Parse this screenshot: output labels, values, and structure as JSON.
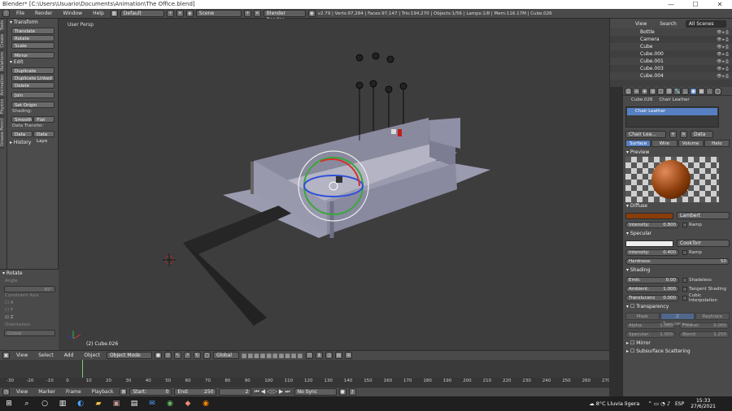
{
  "window": {
    "title": "Blender* [C:\\Users\\Usuario\\Documents\\Animation\\The Office.blend]",
    "min": "—",
    "max": "☐",
    "close": "✕"
  },
  "infobar": {
    "menus": [
      "File",
      "Render",
      "Window",
      "Help"
    ],
    "layout": "Default",
    "scene": "Scene",
    "engine": "Blender Render",
    "stats": "v2.79 | Verts:97,284 | Faces:97,147 | Tris:194,270 | Objects:1/56 | Lamps:1/8 | Mem:116.17M | Cube.026"
  },
  "vtabs": [
    "Tools",
    "Create",
    "Relations",
    "Animation",
    "Physics",
    "Grease Pencil"
  ],
  "tools": {
    "transform_head": "Transform",
    "translate": "Translate",
    "rotate": "Rotate",
    "scale": "Scale",
    "mirror": "Mirror",
    "edit_head": "Edit",
    "duplicate": "Duplicate",
    "duplicate_linked": "Duplicate Linked",
    "delete": "Delete",
    "join": "Join",
    "set_origin": "Set Origin",
    "shading_label": "Shading:",
    "smooth": "Smooth",
    "flat": "Flat",
    "data_transfer_label": "Data Transfer:",
    "data": "Data",
    "data_layout": "Data Layo",
    "history_head": "History"
  },
  "rotate_panel": {
    "head": "Rotate",
    "angle_label": "Angle",
    "angle_value": "45°",
    "constraint_label": "Constraint Axis",
    "x": "X",
    "y": "Y",
    "z": "Z",
    "orientation_label": "Orientation",
    "orientation_value": "Global"
  },
  "viewport": {
    "label": "User Persp",
    "object": "(2) Cube.026"
  },
  "viewport_header": {
    "view": "View",
    "select": "Select",
    "add": "Add",
    "object": "Object",
    "mode": "Object Mode",
    "orientation": "Global"
  },
  "timeline": {
    "ticks": [
      "-30",
      "-20",
      "-10",
      "0",
      "10",
      "20",
      "30",
      "40",
      "50",
      "60",
      "70",
      "80",
      "90",
      "100",
      "110",
      "120",
      "130",
      "140",
      "150",
      "160",
      "170",
      "180",
      "190",
      "200",
      "210",
      "220",
      "230",
      "240",
      "250",
      "260",
      "270"
    ]
  },
  "timeline_header": {
    "view": "View",
    "marker": "Marker",
    "frame": "Frame",
    "playback": "Playback",
    "start_label": "Start:",
    "start_value": "0",
    "end_label": "End:",
    "end_value": "250",
    "current": "2",
    "sync": "No Sync"
  },
  "outliner": {
    "view": "View",
    "search": "Search",
    "filter": "All Scenes",
    "rows": [
      "Bottle",
      "Camera",
      "Cube",
      "Cube.000",
      "Cube.001",
      "Cube.003",
      "Cube.004"
    ]
  },
  "properties": {
    "breadcrumb_obj": "Cube.026",
    "breadcrumb_mat": "Chair Leather",
    "material_slot": "Chair Leather",
    "material_field": "Chair Lea...",
    "data": "Data",
    "tabs": [
      "Surface",
      "Wire",
      "Volume",
      "Halo"
    ],
    "preview_head": "Preview",
    "diffuse_head": "Diffuse",
    "diffuse_color": "#8a3d0a",
    "diffuse_shader": "Lambert",
    "intensity_label": "Intensity:",
    "diffuse_intensity": "0.800",
    "ramp": "Ramp",
    "specular_head": "Specular",
    "specular_shader": "CookTorr",
    "specular_intensity": "0.400",
    "hardness_label": "Hardness:",
    "hardness_value": "50",
    "shading_head": "Shading",
    "emit_label": "Emit:",
    "emit_value": "0.00",
    "ambient_label": "Ambient:",
    "ambient_value": "1.000",
    "translucency_label": "Translucenc",
    "translucency_value": "0.000",
    "shadeless": "Shadeless",
    "tangent": "Tangent Shading",
    "cubic": "Cubic Interpolation",
    "transparency_head": "Transparency",
    "tr_tabs": [
      "Mask",
      "Z Transparency",
      "Raytrace"
    ],
    "alpha_label": "Alpha:",
    "alpha_value": "1.000",
    "fresnel_label": "Fresnel:",
    "fresnel_value": "0.000",
    "specular2_label": "Specular:",
    "specular2_value": "1.000",
    "blend_label": "Blend:",
    "blend_value": "1.250",
    "mirror_head": "Mirror",
    "sss_head": "Subsurface Scattering"
  },
  "taskbar": {
    "weather": "8°C  Lluvia ligera",
    "lang": "ESP",
    "time": "15:33",
    "date": "27/6/2021"
  }
}
